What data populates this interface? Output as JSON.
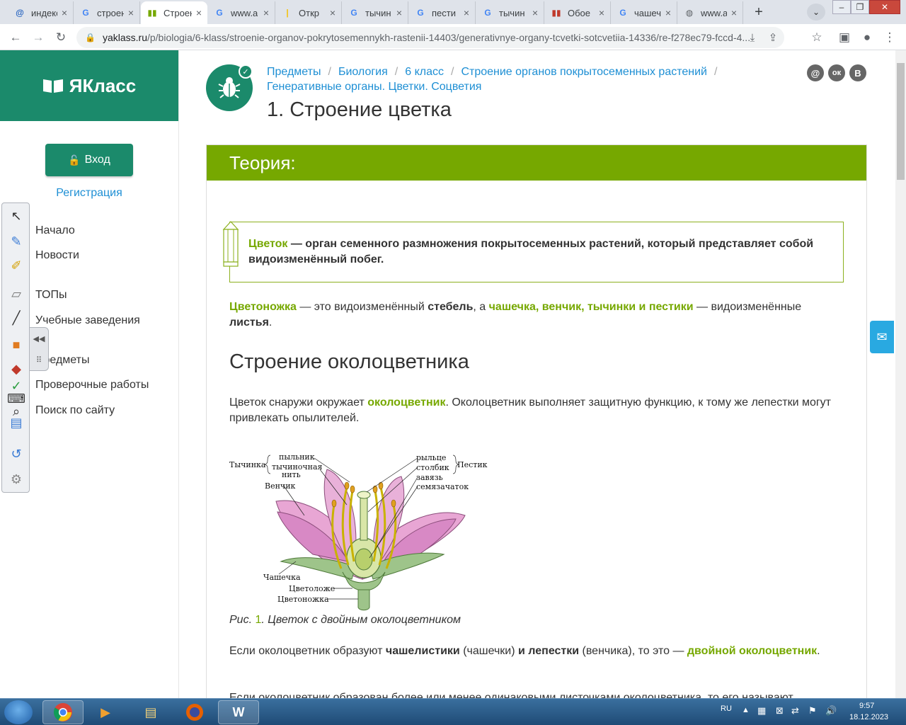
{
  "tabs": [
    {
      "label": "индекс",
      "icon": "@",
      "icon_color": "#1f5fbf"
    },
    {
      "label": "строение",
      "icon": "G",
      "icon_color": "#4285f4"
    },
    {
      "label": "Строение",
      "icon": "▮▮",
      "icon_color": "#76a800"
    },
    {
      "label": "www.a",
      "icon": "G",
      "icon_color": "#4285f4"
    },
    {
      "label": "Откр",
      "icon": "|",
      "icon_color": "#f4c20d"
    },
    {
      "label": "тычин",
      "icon": "G",
      "icon_color": "#4285f4"
    },
    {
      "label": "пести",
      "icon": "G",
      "icon_color": "#4285f4"
    },
    {
      "label": "тычин",
      "icon": "G",
      "icon_color": "#4285f4"
    },
    {
      "label": "Обое",
      "icon": "▮▮",
      "icon_color": "#c0392b"
    },
    {
      "label": "чашеч",
      "icon": "G",
      "icon_color": "#4285f4"
    },
    {
      "label": "www.a",
      "icon": "◍",
      "icon_color": "#5f6368"
    }
  ],
  "browser": {
    "url_domain": "yaklass.ru",
    "url_path": "/p/biologia/6-klass/stroenie-organov-pokrytosemennykh-rastenii-14403/generativnye-organy-tcvetki-sotcvetiia-14336/re-f278ec79-fccd-4..."
  },
  "sidebar": {
    "logo_text": "ЯКласс",
    "login_label": "Вход",
    "register_label": "Регистрация",
    "menu": [
      "Начало",
      "Новости",
      "ТОПы",
      "Учебные заведения",
      "Предметы",
      "Проверочные работы",
      "Поиск по сайту"
    ]
  },
  "breadcrumbs": [
    "Предметы",
    "Биология",
    "6 класс",
    "Строение органов покрытосеменных растений",
    "Генеративные органы. Цветки. Соцветия"
  ],
  "page_title": "1. Строение цветка",
  "social": [
    "@",
    "ок",
    "В"
  ],
  "theory": {
    "header": "Теория:",
    "definition_term": "Цветок",
    "definition_text": " — орган семенного размножения покрытосеменных растений, который представляет собой видоизменённый побег.",
    "p1_term": "Цветоножка",
    "p1_a": " — это видоизменённый ",
    "p1_stem": "стебель",
    "p1_b": ", а ",
    "p1_parts": "чашечка, венчик, тычинки и пестики",
    "p1_c": " — видоизменённые ",
    "p1_leaves": "листья",
    "p1_d": ".",
    "h2": "Строение околоцветника",
    "p2_a": "Цветок снаружи окружает ",
    "p2_term": "околоцветник",
    "p2_b": ". Околоцветник выполняет защитную функцию, к тому же лепестки могут привлекать опылителей.",
    "caption_prefix": "Рис. ",
    "caption_num": "1",
    "caption_text": ". Цветок с двойным околоцветником",
    "p3_a": "Если околоцветник образуют ",
    "p3_b": "чашелистики",
    "p3_c": " (чашечки) ",
    "p3_d": "и лепестки",
    "p3_e": " (венчика), то это — ",
    "p3_term": "двойной околоцветник",
    "p3_f": ".",
    "p4": "Если околоцветник образован более или менее одинаковыми листочками околоцветника, то его называют"
  },
  "figure_labels": {
    "stamen": "Тычинка",
    "anther": "пыльник",
    "filament_1": "тычиночная",
    "filament_2": "нить",
    "corolla": "Венчик",
    "stigma": "рыльце",
    "style": "столбик",
    "pistil": "Пестик",
    "ovary": "завязь",
    "ovule": "семязачаток",
    "calyx": "Чашечка",
    "receptacle": "Цветоложе",
    "pedicel": "Цветоножка"
  },
  "taskbar": {
    "lang": "RU",
    "time": "9:57",
    "date": "18.12.2023"
  },
  "colors": {
    "brand_green": "#1b8a6b",
    "theory_green": "#76a800",
    "link_blue": "#1e8fd4"
  }
}
